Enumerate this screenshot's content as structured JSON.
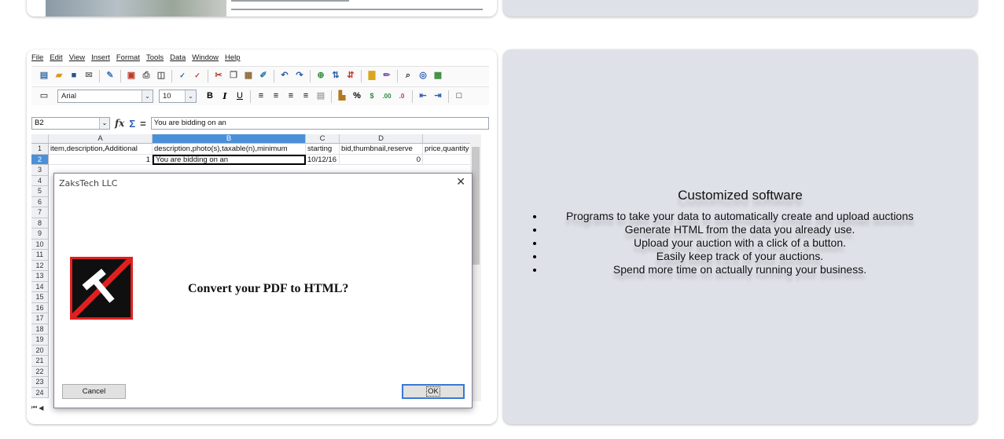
{
  "spreadsheet": {
    "menu": [
      "File",
      "Edit",
      "View",
      "Insert",
      "Format",
      "Tools",
      "Data",
      "Window",
      "Help"
    ],
    "font_name": "Arial",
    "font_size": "10",
    "cell_ref": "B2",
    "formula_value": "You are bidding on an",
    "columns": [
      "A",
      "B",
      "C",
      "D"
    ],
    "rows": [
      "1",
      "2",
      "3",
      "4",
      "5",
      "6",
      "7",
      "8",
      "9",
      "10",
      "11",
      "12",
      "13",
      "14",
      "15",
      "16",
      "17",
      "18",
      "19",
      "20",
      "21",
      "22",
      "23",
      "24"
    ],
    "row1": [
      "item,description,Additional",
      "description,photo(s),taxable(n),minimum",
      "starting",
      "bid,thumbnail,reserve",
      "price,quantity"
    ],
    "row2": [
      "1",
      "You are bidding on an",
      "10/12/16",
      "0",
      ""
    ]
  },
  "dialog": {
    "title": "ZaksTech LLC",
    "close": "✕",
    "message": "Convert your PDF to HTML?",
    "cancel": "Cancel",
    "ok": "OK"
  },
  "feature_panel": {
    "title": "Customized software",
    "items": [
      "Programs to take your data to automatically create and upload auctions",
      "Generate HTML from the data you already use.",
      "Upload your auction with a click of a button.",
      "Easily keep track of your auctions.",
      "Spend more time on actually running your business."
    ]
  }
}
